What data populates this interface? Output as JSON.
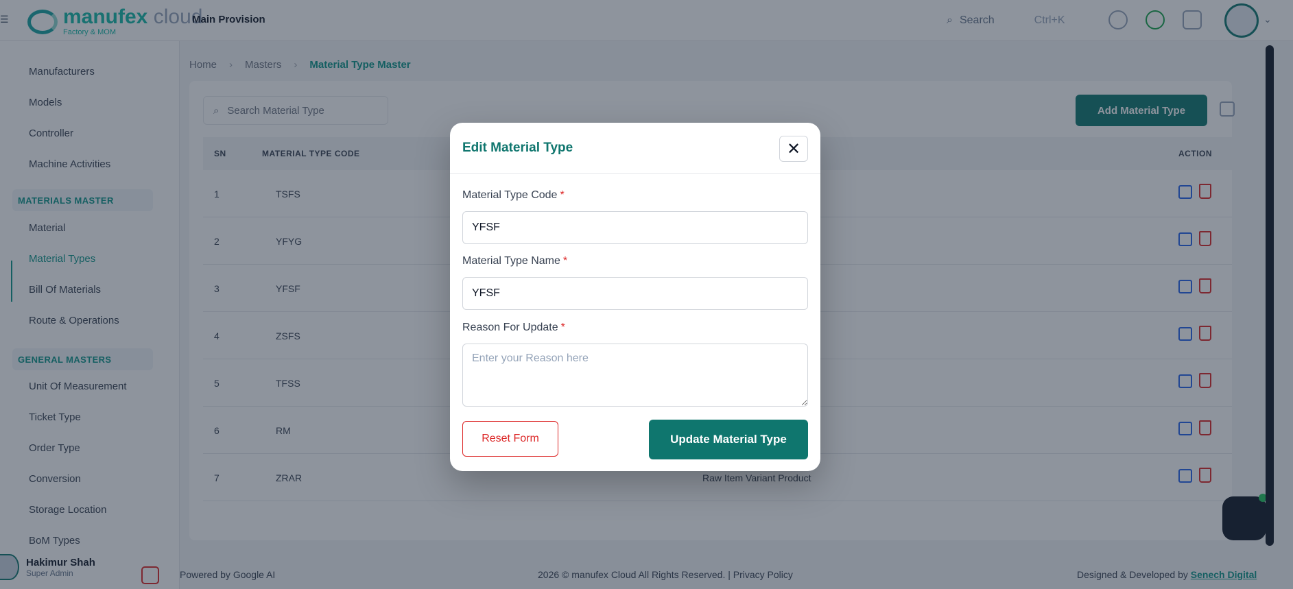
{
  "header": {
    "page_name": "Main Provision",
    "logo_main": "manufex",
    "logo_cloud": "cloud",
    "logo_sub": "Factory & MOM",
    "search_label": "Search",
    "search_shortcut": "Ctrl+K",
    "icons": [
      "menu-icon",
      "search-icon",
      "settings-icon",
      "bell-icon",
      "chat-icon"
    ]
  },
  "sidebar": {
    "items_top": [
      "Manufacturers",
      "Models",
      "Controller",
      "Machine Activities"
    ],
    "section_material": "MATERIALS MASTER",
    "items_material": [
      "Material",
      "Material Types",
      "Bill Of Materials",
      "Route & Operations"
    ],
    "section_general": "GENERAL MASTERS",
    "items_general": [
      "Unit Of Measurement",
      "Ticket Type",
      "Order Type",
      "Conversion",
      "Storage Location",
      "BoM Types"
    ],
    "user_name": "Hakimur Shah",
    "user_role": "Super Admin"
  },
  "breadcrumb": [
    "Home",
    "Masters",
    "Material Type Master"
  ],
  "main": {
    "search_placeholder": "Search Material Type",
    "add_label": "Add Material Type",
    "columns": [
      "SN",
      "MATERIAL TYPE CODE",
      "ACTION"
    ],
    "rows": [
      {
        "sn": "1",
        "code": "TSFS"
      },
      {
        "sn": "2",
        "code": "YFYG"
      },
      {
        "sn": "3",
        "code": "YFSF"
      },
      {
        "sn": "4",
        "code": "ZSFS"
      },
      {
        "sn": "5",
        "code": "TFSS"
      },
      {
        "sn": "6",
        "code": "RM"
      },
      {
        "sn": "7",
        "code": "ZRAR",
        "extra": "Raw Item Variant Product"
      }
    ]
  },
  "footer": {
    "powered": "Powered by  Google AI",
    "copyright": "2026 © manufex Cloud All Rights Reserved. | Privacy Policy",
    "developed_prefix": "Designed & Developed by",
    "developed_by": "Senech Digital"
  },
  "modal": {
    "title": "Edit Material Type",
    "code_label": "Material Type Code",
    "code_value": "YFSF",
    "name_label": "Material Type Name",
    "name_value": "YFSF",
    "reason_label": "Reason For Update",
    "reason_placeholder": "Enter your Reason here",
    "required_mark": "*",
    "reset_label": "Reset Form",
    "update_label": "Update Material Type",
    "close_symbol": "✕"
  }
}
